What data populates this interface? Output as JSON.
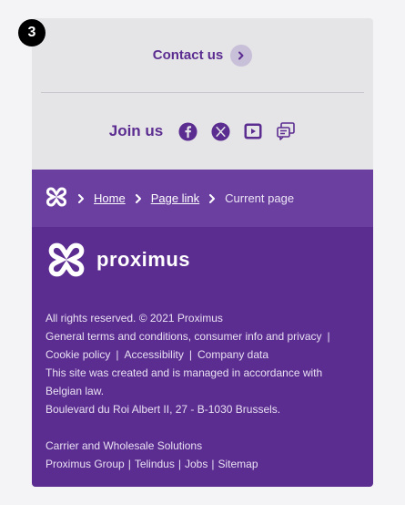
{
  "step_badge": "3",
  "contact": {
    "label": "Contact us"
  },
  "join": {
    "label": "Join us",
    "socials": [
      "facebook-icon",
      "x-icon",
      "youtube-icon",
      "chat-icon"
    ]
  },
  "breadcrumb": {
    "home": "Home",
    "page_link": "Page link",
    "current": "Current page"
  },
  "footer": {
    "brand": "proximus",
    "copyright": "All rights reserved. © 2021 Proximus",
    "links_row1": [
      "General terms and conditions, consumer info and privacy"
    ],
    "links_row2": [
      "Cookie policy",
      "Accessibility",
      "Company data"
    ],
    "notice_line1": "This site was created and is managed in accordance with",
    "notice_line2": "Belgian law.",
    "address": "Boulevard du Roi Albert II, 27 - B-1030 Brussels.",
    "carrier": "Carrier and Wholesale Solutions",
    "bottom_links": [
      "Proximus Group",
      "Telindus",
      "Jobs",
      "Sitemap"
    ]
  },
  "colors": {
    "brand_purple": "#5c2d91",
    "breadcrumb_bg": "#6b3fa0",
    "panel_bg": "#e5e4e7"
  }
}
